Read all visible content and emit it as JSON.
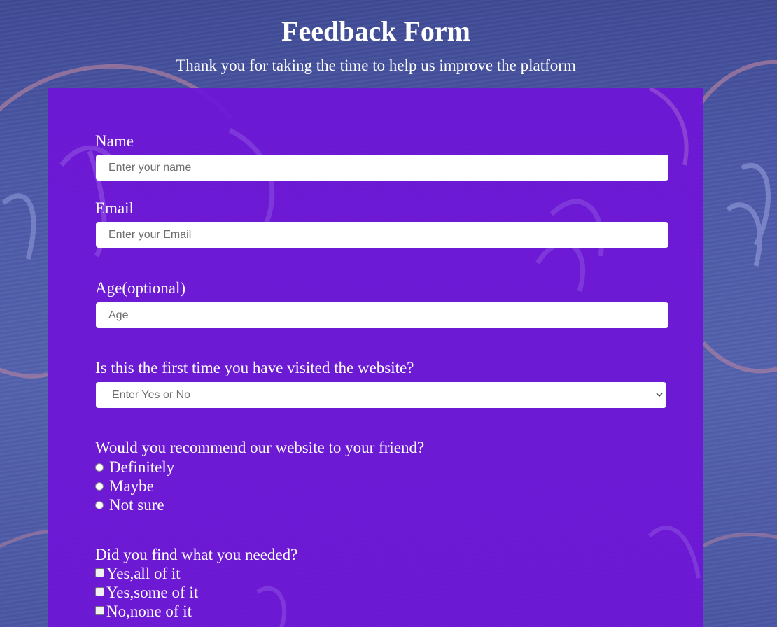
{
  "header": {
    "title": "Feedback Form",
    "subtitle": "Thank you for taking the time to help us improve the platform"
  },
  "form": {
    "name": {
      "label": "Name",
      "placeholder": "Enter your name",
      "value": ""
    },
    "email": {
      "label": "Email",
      "placeholder": "Enter your Email",
      "value": ""
    },
    "age": {
      "label": "Age(optional)",
      "placeholder": "Age",
      "value": ""
    },
    "first_visit": {
      "label": "Is this the first time you have visited the website?",
      "selected": "Enter Yes or No"
    },
    "recommend": {
      "label": "Would you recommend our website to your friend?",
      "options": [
        "Definitely",
        "Maybe",
        "Not sure"
      ]
    },
    "found_needed": {
      "label": "Did you find what you needed?",
      "options": [
        "Yes,all of it",
        "Yes,some of it",
        "No,none of it"
      ]
    }
  },
  "colors": {
    "background": "#4d59a8",
    "panel": "#6f16d7",
    "text": "#ffffff",
    "input_bg": "#ffffff",
    "placeholder": "#6f6f6f"
  },
  "icons": {
    "select_arrow": "chevron-down-icon"
  }
}
